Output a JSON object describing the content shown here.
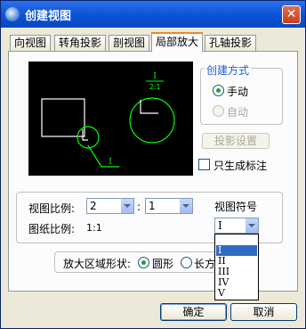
{
  "window": {
    "title": "创建视图",
    "close_glyph": "✕"
  },
  "tabs": [
    {
      "label": "向视图"
    },
    {
      "label": "转角投影"
    },
    {
      "label": "剖视图"
    },
    {
      "label": "局部放大"
    },
    {
      "label": "孔轴投影"
    }
  ],
  "preview": {
    "label_number": "I",
    "label_ratio": "2:1",
    "leader_label": "I"
  },
  "create_mode": {
    "legend": "创建方式",
    "manual_label": "手动",
    "auto_label": "自动",
    "projection_settings": "投影设置"
  },
  "only_annotation_label": "只生成标注",
  "scale": {
    "view_label": "视图比例:",
    "view_numerator": "2",
    "colon": ":",
    "view_denominator": "1",
    "paper_label": "图纸比例:",
    "paper_value": "1:1"
  },
  "symbol": {
    "label": "视图符号",
    "selected": "I",
    "options": [
      "",
      "I",
      "II",
      "III",
      "IV",
      "V"
    ]
  },
  "shape": {
    "label": "放大区域形状:",
    "circle_label": "圆形",
    "rect_label": "长方"
  },
  "buttons": {
    "ok": "确定",
    "cancel": "取消"
  },
  "colors": {
    "preview_line": "#00ff00",
    "preview_white": "#ffffff",
    "accent": "#1d5ed6"
  }
}
